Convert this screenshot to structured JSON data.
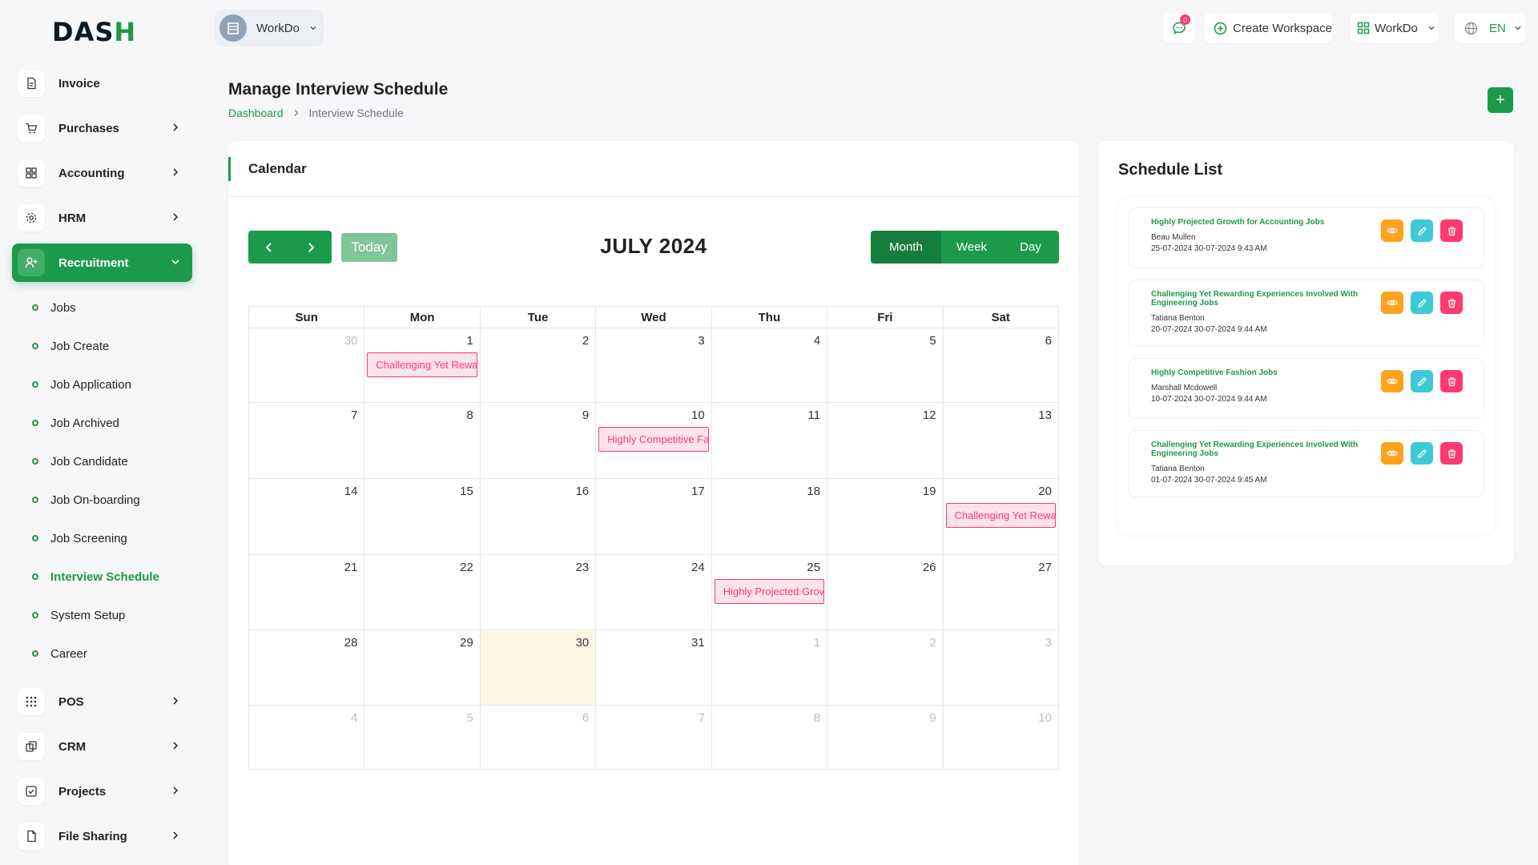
{
  "brand": {
    "logo_main": "DAS",
    "logo_accent": "H"
  },
  "colors": {
    "primary": "#1b9a4b",
    "event_text": "#ff3a6e",
    "event_bg": "#fde4ea",
    "view": "#ffa21d",
    "edit": "#3ec9d6",
    "delete": "#ff3a6e",
    "today_bg": "#fdf8e3"
  },
  "sidebar": {
    "items_top": [
      {
        "label": "Invoice",
        "icon": "file-icon",
        "has_chevron": false
      },
      {
        "label": "Purchases",
        "icon": "cart-icon",
        "has_chevron": true
      },
      {
        "label": "Accounting",
        "icon": "grid-icon",
        "has_chevron": true
      },
      {
        "label": "HRM",
        "icon": "gear-icon",
        "has_chevron": true
      },
      {
        "label": "Recruitment",
        "icon": "user-plus-icon",
        "has_chevron": true
      }
    ],
    "submenu": [
      {
        "label": "Jobs"
      },
      {
        "label": "Job Create"
      },
      {
        "label": "Job Application"
      },
      {
        "label": "Job Archived"
      },
      {
        "label": "Job Candidate"
      },
      {
        "label": "Job On-boarding"
      },
      {
        "label": "Job Screening"
      },
      {
        "label": "Interview Schedule"
      },
      {
        "label": "System Setup"
      },
      {
        "label": "Career"
      }
    ],
    "items_bottom": [
      {
        "label": "POS",
        "icon": "dots-grid-icon",
        "has_chevron": true
      },
      {
        "label": "CRM",
        "icon": "layers-icon",
        "has_chevron": true
      },
      {
        "label": "Projects",
        "icon": "checkbox-icon",
        "has_chevron": true
      },
      {
        "label": "File Sharing",
        "icon": "document-icon",
        "has_chevron": true
      }
    ]
  },
  "topbar": {
    "workspace_name": "WorkDo",
    "notif_count": "0",
    "create_workspace": "Create Workspace",
    "workdo_menu": "WorkDo",
    "language": "EN"
  },
  "page": {
    "title": "Manage Interview Schedule",
    "breadcrumb_home": "Dashboard",
    "breadcrumb_current": "Interview Schedule",
    "add_label": "+"
  },
  "calendar": {
    "card_title": "Calendar",
    "today_label": "Today",
    "month_title": "JULY 2024",
    "views": [
      "Month",
      "Week",
      "Day"
    ],
    "dow": [
      "Sun",
      "Mon",
      "Tue",
      "Wed",
      "Thu",
      "Fri",
      "Sat"
    ],
    "weeks": [
      [
        {
          "d": "30",
          "m": true
        },
        {
          "d": "1",
          "e": "Challenging Yet Rewa"
        },
        {
          "d": "2"
        },
        {
          "d": "3"
        },
        {
          "d": "4"
        },
        {
          "d": "5"
        },
        {
          "d": "6"
        }
      ],
      [
        {
          "d": "7"
        },
        {
          "d": "8"
        },
        {
          "d": "9"
        },
        {
          "d": "10",
          "e": "Highly Competitive Fa"
        },
        {
          "d": "11"
        },
        {
          "d": "12"
        },
        {
          "d": "13"
        }
      ],
      [
        {
          "d": "14"
        },
        {
          "d": "15"
        },
        {
          "d": "16"
        },
        {
          "d": "17"
        },
        {
          "d": "18"
        },
        {
          "d": "19"
        },
        {
          "d": "20",
          "e": "Challenging Yet Rewa"
        }
      ],
      [
        {
          "d": "21"
        },
        {
          "d": "22"
        },
        {
          "d": "23"
        },
        {
          "d": "24"
        },
        {
          "d": "25",
          "e": "Highly Projected Grov"
        },
        {
          "d": "26"
        },
        {
          "d": "27"
        }
      ],
      [
        {
          "d": "28"
        },
        {
          "d": "29"
        },
        {
          "d": "30",
          "t": true
        },
        {
          "d": "31"
        },
        {
          "d": "1",
          "m": true
        },
        {
          "d": "2",
          "m": true
        },
        {
          "d": "3",
          "m": true
        }
      ],
      [
        {
          "d": "4",
          "m": true
        },
        {
          "d": "5",
          "m": true
        },
        {
          "d": "6",
          "m": true
        },
        {
          "d": "7",
          "m": true
        },
        {
          "d": "8",
          "m": true
        },
        {
          "d": "9",
          "m": true
        },
        {
          "d": "10",
          "m": true
        }
      ]
    ]
  },
  "schedule": {
    "title": "Schedule List",
    "items": [
      {
        "title": "Highly Projected Growth for Accounting Jobs",
        "name": "Beau Mullen",
        "dates": "25-07-2024 30-07-2024 9:43 AM"
      },
      {
        "title": "Challenging Yet Rewarding Experiences Involved With Engineering Jobs",
        "name": "Tatiana Benton",
        "dates": "20-07-2024 30-07-2024 9:44 AM"
      },
      {
        "title": "Highly Competitive Fashion Jobs",
        "name": "Marshall Mcdowell",
        "dates": "10-07-2024 30-07-2024 9:44 AM"
      },
      {
        "title": "Challenging Yet Rewarding Experiences Involved With Engineering Jobs",
        "name": "Tatiana Benton",
        "dates": "01-07-2024 30-07-2024 9:45 AM"
      }
    ]
  }
}
